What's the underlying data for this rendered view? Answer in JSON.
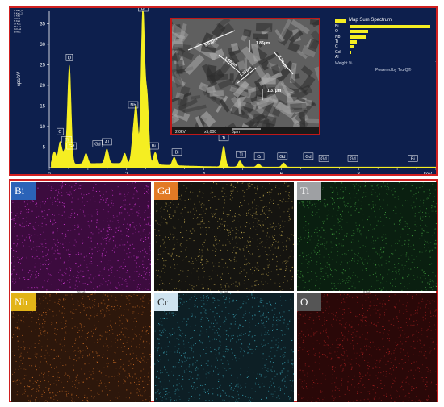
{
  "chart_data": {
    "type": "line",
    "ylabel": "cps/eV",
    "xunit": "keV",
    "xlim": [
      0,
      10
    ],
    "ylim": [
      0,
      38
    ],
    "x_ticks": [
      "0",
      "2",
      "4",
      "6",
      "8"
    ],
    "y_ticks": [
      "5",
      "10",
      "15",
      "20",
      "25",
      "30",
      "35"
    ],
    "series_color": "#f5ee22",
    "peaks": [
      {
        "x": 0.13,
        "y": 3.2
      },
      {
        "x": 0.28,
        "y": 5.5
      },
      {
        "x": 0.4,
        "y": 3.0
      },
      {
        "x": 0.52,
        "y": 24.0
      },
      {
        "x": 0.95,
        "y": 2.5
      },
      {
        "x": 1.49,
        "y": 3.5
      },
      {
        "x": 1.95,
        "y": 2.5
      },
      {
        "x": 2.17,
        "y": 6.0
      },
      {
        "x": 2.25,
        "y": 13.0
      },
      {
        "x": 2.42,
        "y": 38.0
      },
      {
        "x": 2.53,
        "y": 16.0
      },
      {
        "x": 2.74,
        "y": 3.0
      },
      {
        "x": 3.23,
        "y": 2.0
      },
      {
        "x": 4.51,
        "y": 5.0
      },
      {
        "x": 4.93,
        "y": 1.5
      },
      {
        "x": 5.41,
        "y": 0.8
      },
      {
        "x": 6.06,
        "y": 1.0
      }
    ],
    "peak_labels": [
      {
        "text": "C",
        "x": 0.28,
        "y": 8.0
      },
      {
        "text": "Ti",
        "x": 0.45,
        "y": 6.0
      },
      {
        "text": "Gd",
        "x": 0.58,
        "y": 4.5
      },
      {
        "text": "O",
        "x": 0.52,
        "y": 26.0
      },
      {
        "text": "Gd",
        "x": 1.25,
        "y": 5.0
      },
      {
        "text": "Al",
        "x": 1.49,
        "y": 5.5
      },
      {
        "text": "Nb",
        "x": 2.17,
        "y": 14.5
      },
      {
        "text": "Bi",
        "x": 2.43,
        "y": 38.0
      },
      {
        "text": "Bi",
        "x": 2.7,
        "y": 4.5
      },
      {
        "text": "Bi",
        "x": 3.3,
        "y": 3.0
      },
      {
        "text": "Ti",
        "x": 4.51,
        "y": 6.5
      },
      {
        "text": "Ti",
        "x": 4.96,
        "y": 2.5
      },
      {
        "text": "Cr",
        "x": 5.43,
        "y": 2.0
      },
      {
        "text": "Gd",
        "x": 6.03,
        "y": 2.0
      },
      {
        "text": "Gd",
        "x": 6.7,
        "y": 2.0
      },
      {
        "text": "Gd",
        "x": 7.1,
        "y": 1.5
      },
      {
        "text": "Gd",
        "x": 7.85,
        "y": 1.5
      },
      {
        "text": "Bi",
        "x": 9.4,
        "y": 1.5
      }
    ],
    "legend": {
      "title": "Map Sum Spectrum",
      "entries": [
        {
          "name": "Bi",
          "value": 66
        },
        {
          "name": "O",
          "value": 15
        },
        {
          "name": "Nb",
          "value": 13
        },
        {
          "name": "Ti",
          "value": 6
        },
        {
          "name": "C",
          "value": 3
        },
        {
          "name": "Gd",
          "value": 1
        },
        {
          "name": "Al",
          "value": 0.3
        }
      ],
      "axis_label": "Weight %",
      "axis_max": "70",
      "credit": "Powered by Tru-Q®"
    }
  },
  "sem_inset": {
    "measurements": [
      "5.97μm",
      "1.86μm",
      "1.88μm",
      "1.37μm",
      "3.34μm",
      "1.37μm"
    ],
    "footer": [
      "2.0kV",
      "x5,000",
      "5μm"
    ],
    "colors": {
      "base": "#5f5f5f",
      "light": "#a8a8a8",
      "dark": "#2e2e2e"
    }
  },
  "maps": [
    {
      "element": "Bi",
      "caption": "Bi Ma1",
      "tag_color": "#2b63b8",
      "base": "#3c0b3e",
      "speck": "#d23ad6"
    },
    {
      "element": "Gd",
      "caption": "Gd La1",
      "tag_color": "#e27a25",
      "base": "#151410",
      "speck": "#b8a04a"
    },
    {
      "element": "Ti",
      "caption": "Ti Ka1",
      "tag_color": "#9ea0a3",
      "base": "#0a1f10",
      "speck": "#3f9a3c"
    },
    {
      "element": "Nb",
      "caption": "Nb La1",
      "tag_color": "#e2b418",
      "base": "#2d170b",
      "speck": "#cc6d25"
    },
    {
      "element": "Cr",
      "caption": "Cr Ka1",
      "tag_color": "#cfe3ef",
      "base": "#0d1f25",
      "speck": "#3aa3b5"
    },
    {
      "element": "O",
      "caption": "O Ka1",
      "tag_color": "#555555",
      "base": "#2a0808",
      "speck": "#a82020"
    }
  ],
  "header": {
    "lines": [
      "C Ka1_2",
      "N Ka1_2",
      "O Ka1",
      "Al Ka1",
      "Ti Ka1",
      "Cr Ka1",
      "Nb La1",
      "Gd La1",
      "Bi Ma1"
    ]
  }
}
